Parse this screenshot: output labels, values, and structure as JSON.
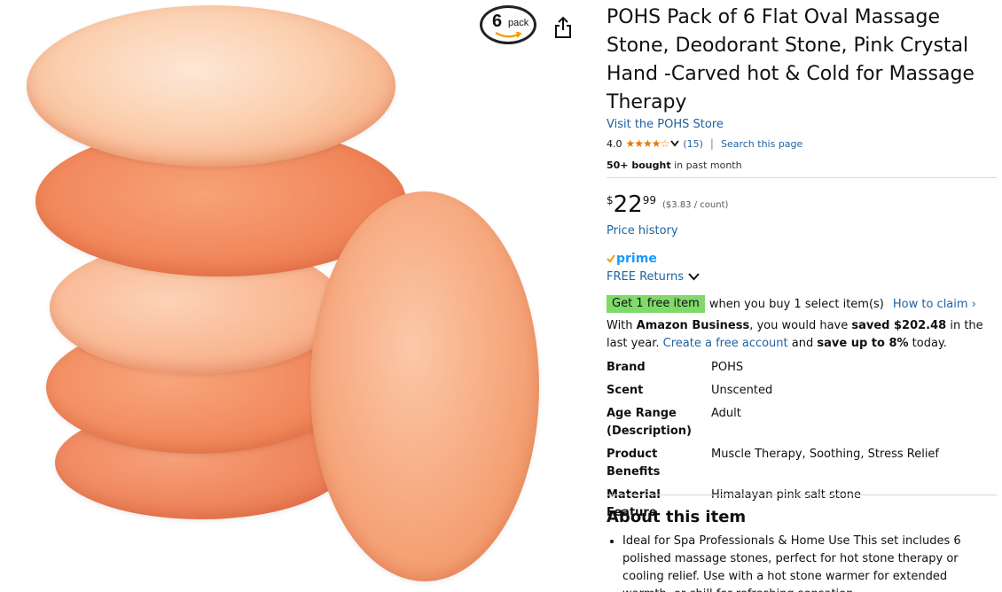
{
  "image": {
    "badge_number": "6",
    "badge_word": "pack",
    "share_icon": "share-icon",
    "colors": {
      "stone_light": "#fbcfae",
      "stone_dark": "#ee7a4e"
    }
  },
  "product": {
    "title": "POHS Pack of 6 Flat Oval Massage Stone, Deodorant Stone, Pink Crystal Hand -Carved hot & Cold for Massage Therapy",
    "store_link": "Visit the POHS Store",
    "rating_value": "4.0",
    "stars": 4,
    "stars_max": 5,
    "review_count": "(15)",
    "search_page": "Search this page",
    "bought_bold": "50+ bought",
    "bought_rest": " in past month",
    "price_symbol": "$",
    "price_whole": "22",
    "price_fraction": "99",
    "unit_price": "($3.83 / count)",
    "price_history": "Price history",
    "prime_label": "prime",
    "free_returns": "FREE Returns",
    "promo_badge": "Get 1 free item",
    "promo_text": "when you buy 1 select item(s)",
    "promo_link": "How to claim ›",
    "biz_1": "With ",
    "biz_2": "Amazon Business",
    "biz_3": ", you would have ",
    "biz_4": "saved $202.48",
    "biz_5": " in the last year. ",
    "biz_6": "Create a free account",
    "biz_7": " and ",
    "biz_8": "save up to 8%",
    "biz_9": " today.",
    "colors": {
      "link": "#2162a1",
      "prime": "#1a98ff",
      "promo_bg": "#7fda69",
      "star": "#e67a00"
    }
  },
  "specs": [
    {
      "label": "Brand",
      "value": "POHS"
    },
    {
      "label": "Scent",
      "value": "Unscented"
    },
    {
      "label": "Age Range (Description)",
      "value": "Adult"
    },
    {
      "label": "Product Benefits",
      "value": "Muscle Therapy, Soothing, Stress Relief"
    },
    {
      "label": "Material Feature",
      "value": "Himalayan pink salt stone"
    }
  ],
  "about": {
    "heading": "About this item",
    "bullets": [
      "Ideal for Spa Professionals & Home Use This set includes 6 polished massage stones, perfect for hot stone therapy or cooling relief. Use with a hot stone warmer for extended warmth, or chill for refreshing sensation."
    ]
  }
}
